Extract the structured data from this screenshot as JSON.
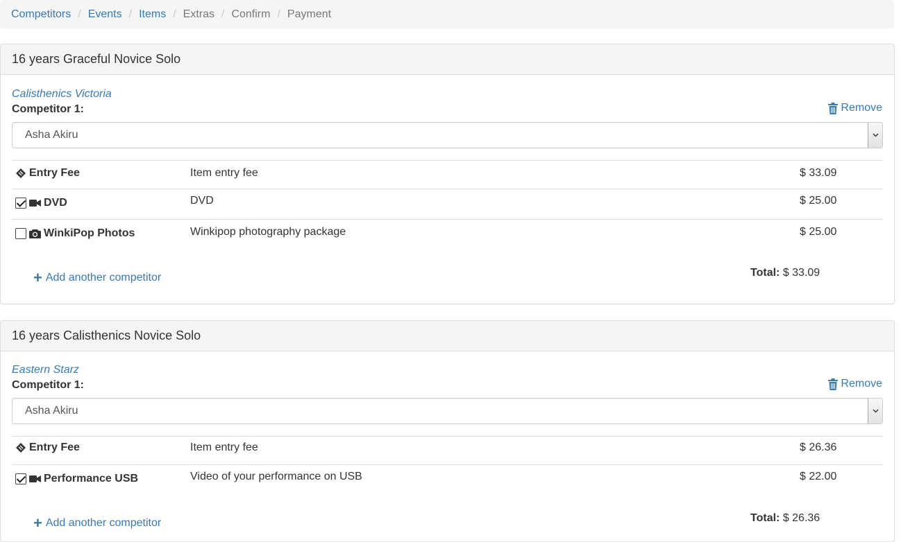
{
  "breadcrumb": [
    {
      "label": "Competitors",
      "active": true
    },
    {
      "label": "Events",
      "active": true
    },
    {
      "label": "Items",
      "active": true
    },
    {
      "label": "Extras",
      "active": false
    },
    {
      "label": "Confirm",
      "active": false
    },
    {
      "label": "Payment",
      "active": false
    }
  ],
  "events": [
    {
      "title": "16 years Graceful Novice Solo",
      "organisation": "Calisthenics Victoria",
      "competitor_label": "Competitor 1:",
      "remove_label": "Remove",
      "selected_competitor": "Asha Akiru",
      "items": [
        {
          "name": "Entry Fee",
          "icon": "ticket-icon",
          "checkbox": null,
          "description": "Item entry fee",
          "price": "$ 33.09"
        },
        {
          "name": "DVD",
          "icon": "video-camera-icon",
          "checkbox": true,
          "description": "DVD",
          "price": "$ 25.00"
        },
        {
          "name": "WinkiPop Photos",
          "icon": "camera-icon",
          "checkbox": false,
          "description": "Winkipop photography package",
          "price": "$ 25.00"
        }
      ],
      "add_label": "Add another competitor",
      "total_label": "Total:",
      "total_value": "$ 33.09"
    },
    {
      "title": "16 years Calisthenics Novice Solo",
      "organisation": "Eastern Starz",
      "competitor_label": "Competitor 1:",
      "remove_label": "Remove",
      "selected_competitor": "Asha Akiru",
      "items": [
        {
          "name": "Entry Fee",
          "icon": "ticket-icon",
          "checkbox": null,
          "description": "Item entry fee",
          "price": "$ 26.36"
        },
        {
          "name": "Performance USB",
          "icon": "video-camera-icon",
          "checkbox": true,
          "description": "Video of your performance on USB",
          "price": "$ 22.00"
        }
      ],
      "add_label": "Add another competitor",
      "total_label": "Total:",
      "total_value": "$ 26.36"
    }
  ],
  "colors": {
    "link": "#337ab7",
    "muted": "#777777",
    "heading_bg": "#f5f5f5"
  }
}
